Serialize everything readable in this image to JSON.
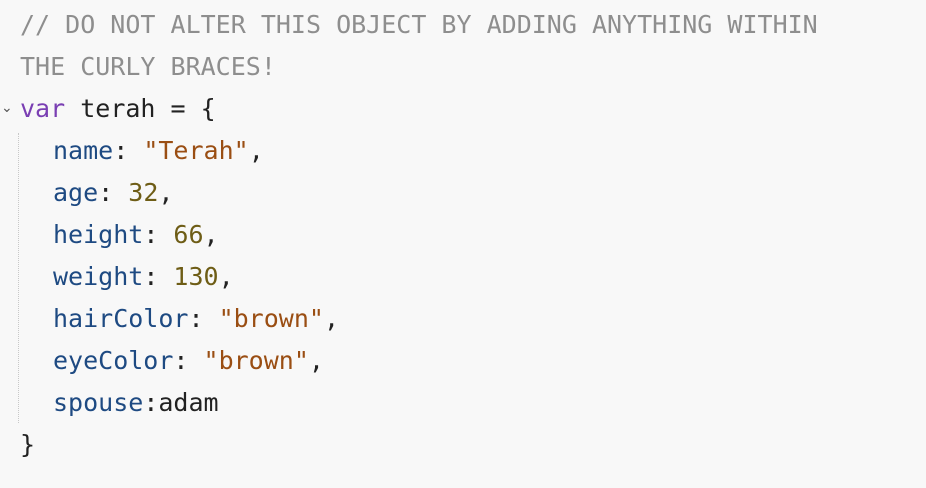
{
  "editor": {
    "comment": {
      "line1": "// DO NOT ALTER THIS OBJECT BY ADDING ANYTHING WITHIN",
      "line2": "THE CURLY BRACES!"
    },
    "declaration": {
      "keyword": "var",
      "name": "terah",
      "operator": "=",
      "open_brace": "{"
    },
    "properties": [
      {
        "key": "name",
        "sep": ": ",
        "value": "\"Terah\"",
        "type": "string",
        "trail": ","
      },
      {
        "key": "age",
        "sep": ": ",
        "value": "32",
        "type": "number",
        "trail": ","
      },
      {
        "key": "height",
        "sep": ": ",
        "value": "66",
        "type": "number",
        "trail": ","
      },
      {
        "key": "weight",
        "sep": ": ",
        "value": "130",
        "type": "number",
        "trail": ","
      },
      {
        "key": "hairColor",
        "sep": ": ",
        "value": "\"brown\"",
        "type": "string",
        "trail": ","
      },
      {
        "key": "eyeColor",
        "sep": ": ",
        "value": "\"brown\"",
        "type": "string",
        "trail": ","
      },
      {
        "key": "spouse",
        "sep": ":",
        "value": "adam",
        "type": "identifier",
        "trail": ""
      }
    ],
    "close_brace": "}",
    "fold_marker_glyph": "⌄"
  }
}
